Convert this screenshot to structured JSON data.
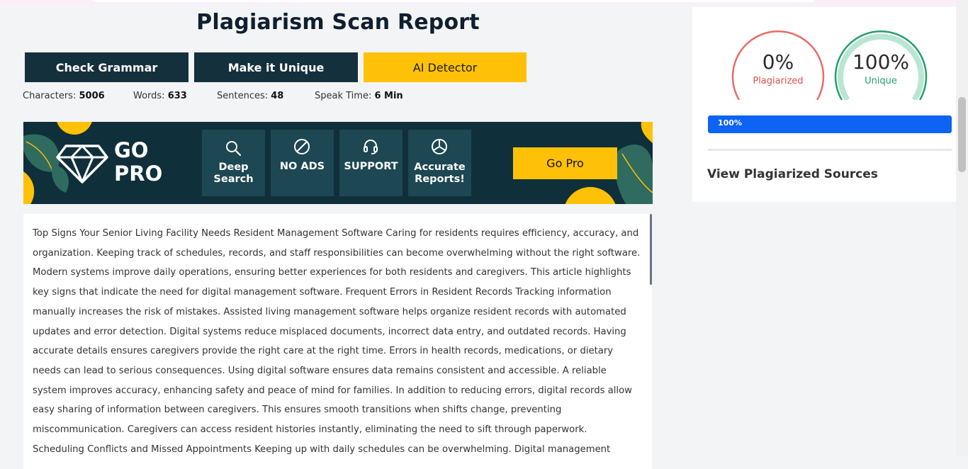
{
  "page": {
    "title": "Plagiarism Scan Report"
  },
  "actions": {
    "check_grammar": "Check Grammar",
    "make_unique": "Make it Unique",
    "ai_detector": "AI Detector"
  },
  "stats": [
    {
      "label": "Characters:",
      "value": "5006"
    },
    {
      "label": "Words:",
      "value": "633"
    },
    {
      "label": "Sentences:",
      "value": "48"
    },
    {
      "label": "Speak Time:",
      "value": "6 Min"
    }
  ],
  "banner": {
    "go": "GO",
    "pro": "PRO",
    "features": [
      {
        "label": "Deep Search",
        "icon": "search-icon"
      },
      {
        "label": "NO ADS",
        "icon": "no-ads-icon"
      },
      {
        "label": "SUPPORT",
        "icon": "headset-icon"
      },
      {
        "label": "Accurate Reports!",
        "icon": "pie-chart-icon"
      }
    ],
    "button": "Go Pro",
    "colors": {
      "background": "#0f2f3b",
      "accent": "#ffc107",
      "tile": "#1c4753"
    }
  },
  "article": {
    "text": "Top Signs Your Senior Living Facility Needs Resident Management Software Caring for residents requires efficiency, accuracy, and organization. Keeping track of schedules, records, and staff responsibilities can become overwhelming without the right software. Modern systems improve daily operations, ensuring better experiences for both residents and caregivers. This article highlights key signs that indicate the need for digital management software. Frequent Errors in Resident Records Tracking information manually increases the risk of mistakes. Assisted living management software helps organize resident records with automated updates and error detection. Digital systems reduce misplaced documents, incorrect data entry, and outdated records. Having accurate details ensures caregivers provide the right care at the right time. Errors in health records, medications, or dietary needs can lead to serious consequences. Using digital software ensures data remains consistent and accessible. A reliable system improves accuracy, enhancing safety and peace of mind for families. In addition to reducing errors, digital records allow easy sharing of information between caregivers. This ensures smooth transitions when shifts change, preventing miscommunication. Caregivers can access resident histories instantly, eliminating the need to sift through paperwork. Scheduling Conflicts and Missed Appointments Keeping up with daily schedules can be overwhelming. Digital management"
  },
  "results": {
    "plagiarized": {
      "value": "0%",
      "label": "Plagiarized",
      "fraction": 0.0,
      "color": "#e0504c"
    },
    "unique": {
      "value": "100%",
      "label": "Unique",
      "fraction": 1.0,
      "color": "#22a06b"
    },
    "progress": {
      "label": "100%",
      "percent": 100,
      "color": "#0d63f3"
    },
    "view_sources": "View Plagiarized Sources"
  }
}
